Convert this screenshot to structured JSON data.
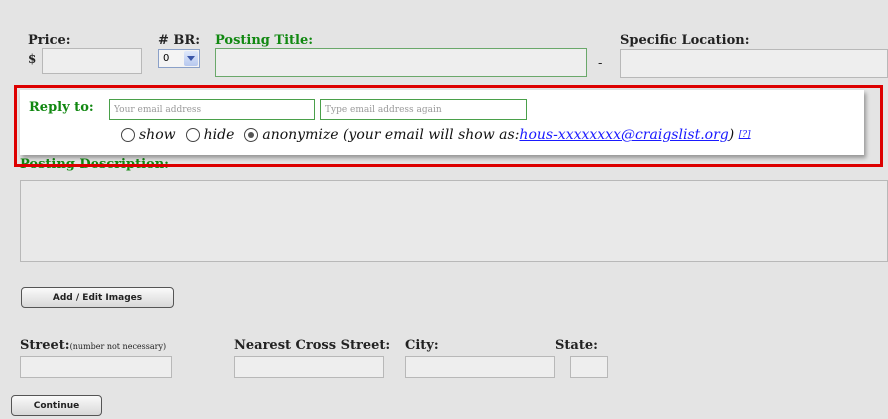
{
  "form": {
    "price_label": "Price:",
    "currency_symbol": "$",
    "price_value": "",
    "br_label": "# BR:",
    "br_selected": "0",
    "title_label": "Posting Title:",
    "title_value": "",
    "separator": "-",
    "location_label": "Specific Location:",
    "location_value": "",
    "description_label": "Posting Description:",
    "add_images_label": "Add / Edit Images",
    "street_label": "Street:",
    "street_note": "(number not necessary)",
    "cross_street_label": "Nearest Cross Street:",
    "city_label": "City:",
    "state_label": "State:",
    "continue_label": "Continue"
  },
  "reply": {
    "label": "Reply to:",
    "email_placeholder": "Your email address",
    "email_again_placeholder": "Type email address again",
    "options": [
      "show",
      "hide",
      "anonymize"
    ],
    "selected": "anonymize",
    "anon_note_prefix": "(your email will show as: ",
    "anon_email": "hous-xxxxxxxx@craigslist.org",
    "anon_note_suffix": ")",
    "help_link": "[?]"
  },
  "colors": {
    "highlight": "#dd0000",
    "label_green": "#118811",
    "link": "#1a1aff"
  }
}
